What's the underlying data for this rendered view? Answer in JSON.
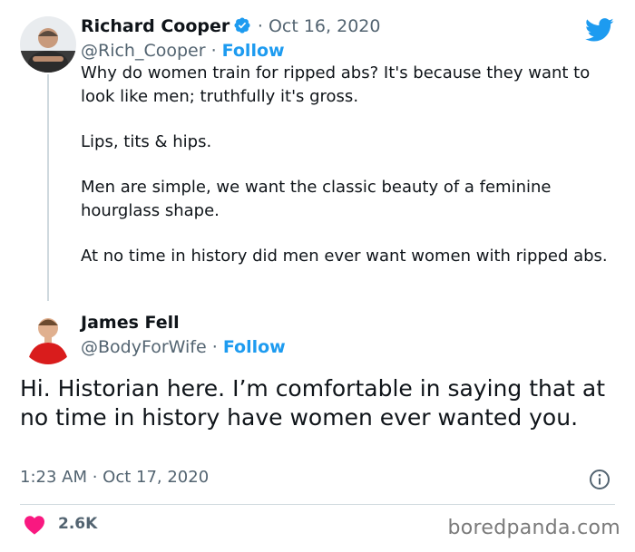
{
  "tweet1": {
    "author_name": "Richard Cooper",
    "date": "· Oct 16, 2020",
    "handle": "@Rich_Cooper",
    "separator": " · ",
    "follow_label": "Follow",
    "paragraphs": [
      "Why do women train for ripped abs?  It's because they want to look like men; truthfully it's gross.",
      "Lips, tits & hips.",
      "Men are simple, we want the classic beauty of a feminine hourglass shape.",
      "At no time in history did men ever want women with ripped abs."
    ]
  },
  "tweet2": {
    "author_name": "James Fell",
    "handle": "@BodyForWife",
    "separator": " · ",
    "follow_label": "Follow",
    "text": "Hi. Historian here. I’m comfortable in saying that at no time in history have women ever wanted you.",
    "timestamp": "1:23 AM · Oct 17, 2020",
    "likes": "2.6K"
  },
  "watermark": "boredpanda.com",
  "colors": {
    "accent": "#1d9bf0",
    "heart": "#f91880",
    "text": "#0f1419",
    "muted": "#536471"
  },
  "icons": [
    "twitter-bird-icon",
    "verified-badge-icon",
    "info-icon",
    "heart-icon"
  ]
}
